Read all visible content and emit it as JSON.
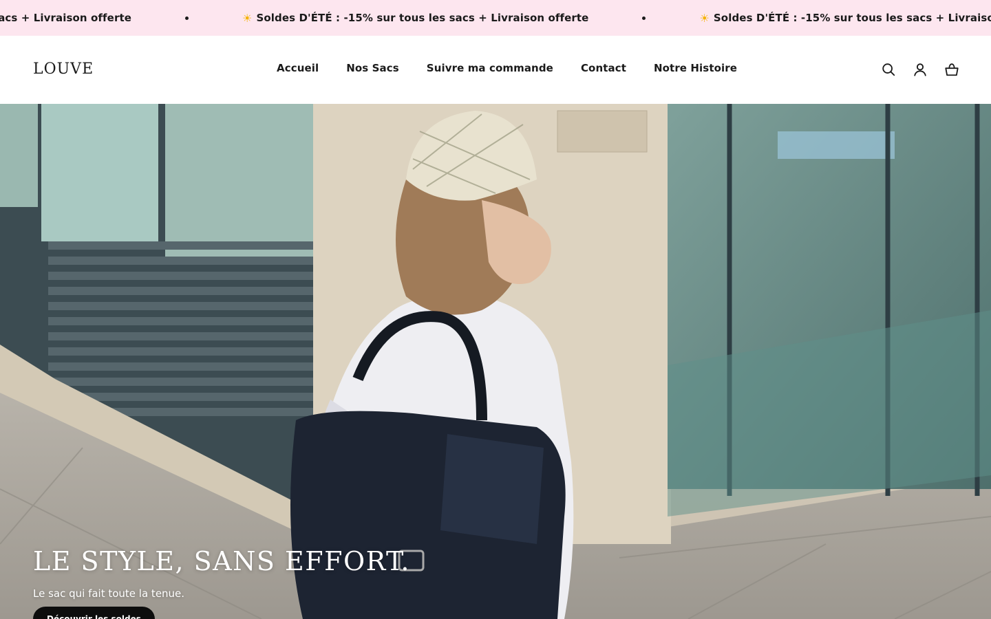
{
  "announcement": {
    "text": "Soldes D'ÉTÉ : -15% sur tous les sacs + Livraison offerte",
    "partial_text": "% sur tous les sacs + Livraison offerte",
    "sun_icon": "sun-icon",
    "background": "#fde6ef"
  },
  "header": {
    "logo": "LOUVE",
    "nav": [
      {
        "label": "Accueil"
      },
      {
        "label": "Nos Sacs"
      },
      {
        "label": "Suivre ma commande"
      },
      {
        "label": "Contact"
      },
      {
        "label": "Notre Histoire"
      }
    ],
    "icons": [
      "search-icon",
      "account-icon",
      "cart-icon"
    ]
  },
  "hero": {
    "title": "LE STYLE, SANS EFFORT.",
    "subtitle": "Le sac qui fait toute la tenue.",
    "cta_label": "Découvrir les soldes",
    "cta_color": "#0d0d0d"
  }
}
